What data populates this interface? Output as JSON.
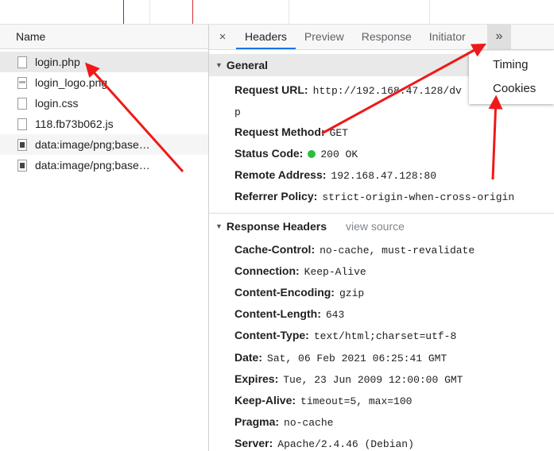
{
  "left_panel": {
    "header": "Name",
    "files": [
      {
        "name": "login.php",
        "icon": "document-icon"
      },
      {
        "name": "login_logo.png",
        "icon": "image-icon"
      },
      {
        "name": "login.css",
        "icon": "document-icon"
      },
      {
        "name": "118.fb73b062.js",
        "icon": "document-icon"
      },
      {
        "name": "data:image/png;base…",
        "icon": "image-icon"
      },
      {
        "name": "data:image/png;base…",
        "icon": "image-icon"
      }
    ]
  },
  "tabs": {
    "close": "×",
    "items": [
      "Headers",
      "Preview",
      "Response",
      "Initiator"
    ],
    "more": "»"
  },
  "dropdown": {
    "items": [
      "Timing",
      "Cookies"
    ]
  },
  "general": {
    "title": "General",
    "request_url_label": "Request URL:",
    "request_url_value": "http://192.168.47.128/dv",
    "request_url_wrap": "p",
    "request_method_label": "Request Method:",
    "request_method_value": "GET",
    "status_code_label": "Status Code:",
    "status_code_value": "200 OK",
    "remote_address_label": "Remote Address:",
    "remote_address_value": "192.168.47.128:80",
    "referrer_policy_label": "Referrer Policy:",
    "referrer_policy_value": "strict-origin-when-cross-origin"
  },
  "response_headers": {
    "title": "Response Headers",
    "view_source": "view source",
    "items": [
      {
        "k": "Cache-Control:",
        "v": "no-cache, must-revalidate"
      },
      {
        "k": "Connection:",
        "v": "Keep-Alive"
      },
      {
        "k": "Content-Encoding:",
        "v": "gzip"
      },
      {
        "k": "Content-Length:",
        "v": "643"
      },
      {
        "k": "Content-Type:",
        "v": "text/html;charset=utf-8"
      },
      {
        "k": "Date:",
        "v": "Sat, 06 Feb 2021 06:25:41 GMT"
      },
      {
        "k": "Expires:",
        "v": "Tue, 23 Jun 2009 12:00:00 GMT"
      },
      {
        "k": "Keep-Alive:",
        "v": "timeout=5, max=100"
      },
      {
        "k": "Pragma:",
        "v": "no-cache"
      },
      {
        "k": "Server:",
        "v": "Apache/2.4.46 (Debian)"
      }
    ]
  },
  "colors": {
    "annotation_arrow": "#f01919",
    "status_ok": "#2ebf3a",
    "active_tab": "#1a73e8"
  }
}
